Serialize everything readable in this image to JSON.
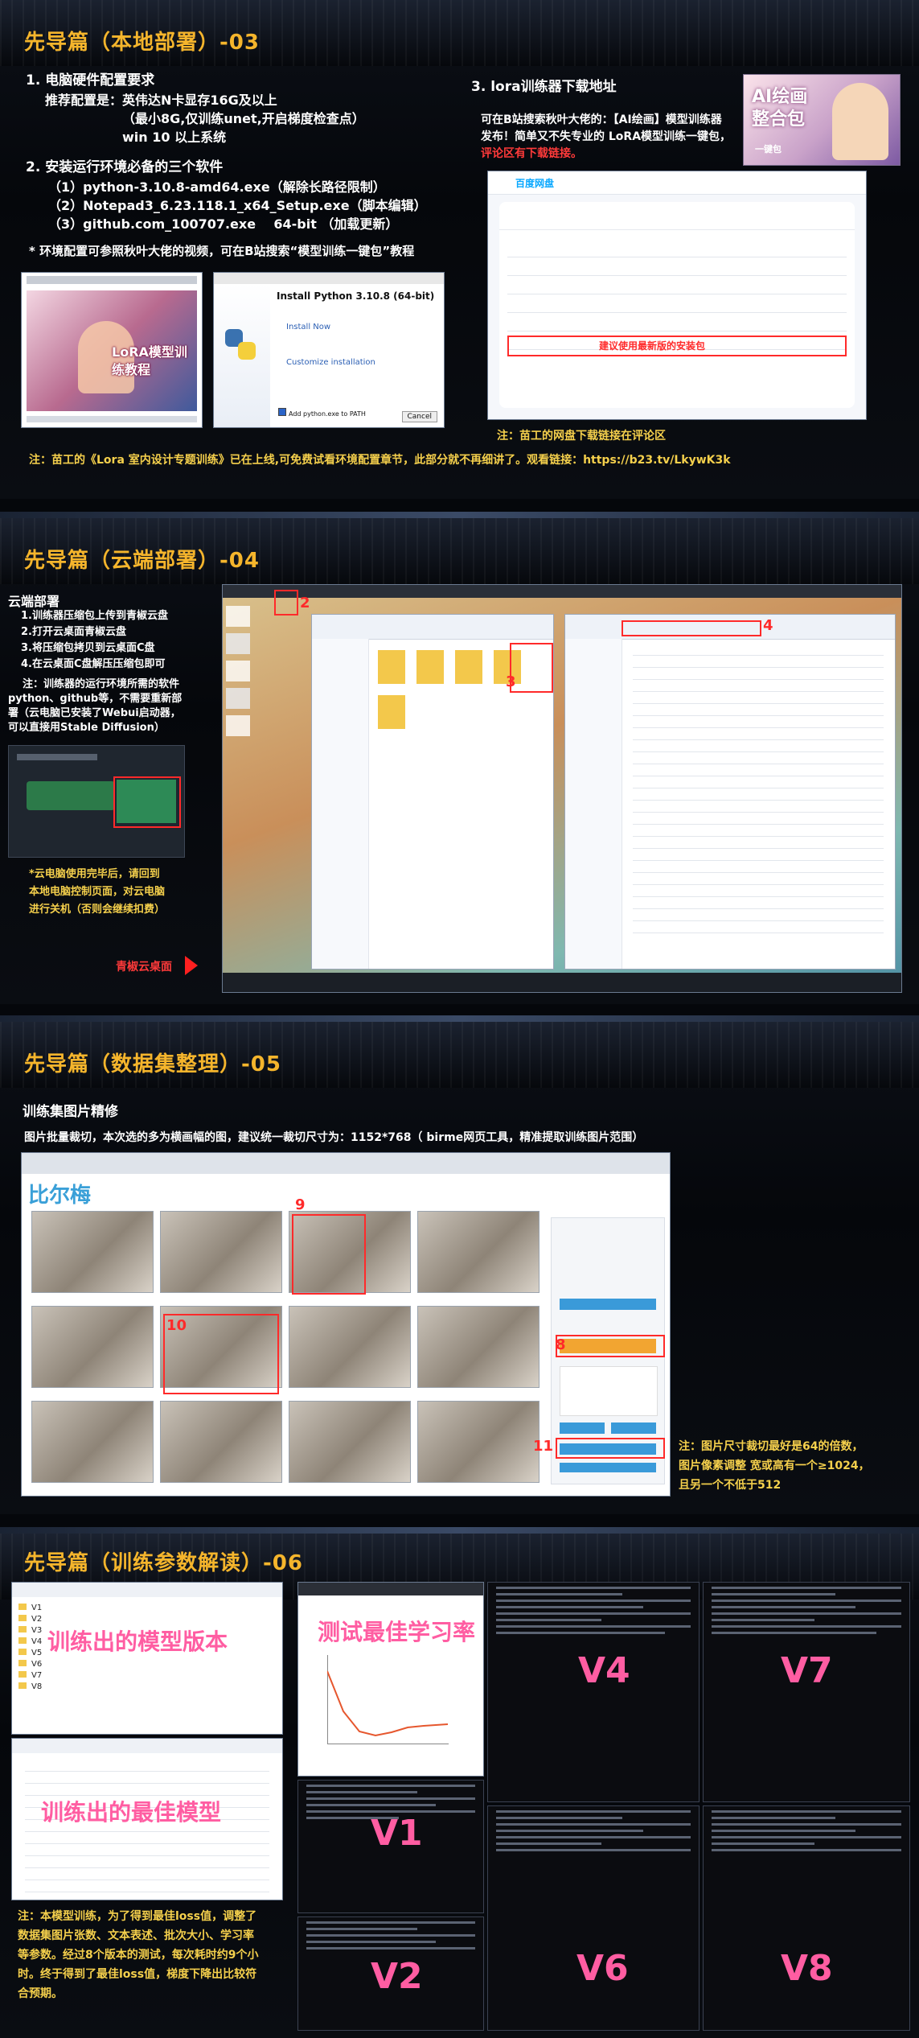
{
  "s1": {
    "title": "先导篇（本地部署）-03",
    "h1": "1. 电脑硬件配置要求",
    "l1": "推荐配置是：英伟达N卡显存16G及以上",
    "l2": "（最小8G,仅训练unet,开启梯度检查点）",
    "l3": "win 10 以上系统",
    "h2": "2. 安装运行环境必备的三个软件",
    "p1": "（1）python-3.10.8-amd64.exe（解除长路径限制）",
    "p2": "（2）Notepad3_6.23.118.1_x64_Setup.exe（脚本编辑）",
    "p3": "（3）github.com_100707.exe    64-bit （加载更新）",
    "tip": "* 环境配置可参照秋叶大佬的视频，可在B站搜索“模型训练一键包”教程",
    "h3": "3. lora训练器下载地址",
    "d1": "可在B站搜索秋叶大佬的：【AI绘画】模型训练器",
    "d2": "发布！简单又不失专业的 LoRA模型训练一键包，",
    "d3": "评论区有下载链接。",
    "badge": "AI绘画整合包",
    "badge_sub": "一键包",
    "pan_logo": "百度网盘",
    "pan_hint": "建议使用最新版的安装包",
    "python_title": "Install Python 3.10.8 (64-bit)",
    "python_now": "Install Now",
    "python_custom": "Customize installation",
    "python_path": "Add python.exe to PATH",
    "python_cancel": "Cancel",
    "thumb_text": "LoRA模型训练教程",
    "pan_note": "注：苗工的网盘下载链接在评论区",
    "bottom": "注：苗工的《Lora 室内设计专题训练》已在上线,可免费试看环境配置章节，此部分就不再细讲了。观看链接：https://b23.tv/LkywK3k"
  },
  "s2": {
    "title": "先导篇（云端部署）-04",
    "h": "云端部署",
    "i1": "1.训练器压缩包上传到青椒云盘",
    "i2": "2.打开云桌面青椒云盘",
    "i3": "3.将压缩包拷贝到云桌面C盘",
    "i4": "4.在云桌面C盘解压压缩包即可",
    "note1": "注：训练器的运行环境所需的软件",
    "note2": "python、github等，不需要重新部",
    "note3": "署（云电脑已安装了Webui启动器，",
    "note4": "可以直接用Stable Diffusion）",
    "warn1": "*云电脑使用完毕后，请回到",
    "warn2": "本地电脑控制页面，对云电脑",
    "warn3": "进行关机（否则会继续扣费）",
    "arrow_label": "青椒云桌面",
    "n2": "2",
    "n3": "3",
    "n4": "4"
  },
  "s3": {
    "title": "先导篇（数据集整理）-05",
    "h": "训练集图片精修",
    "sub": "图片批量裁切，本次选的多为横画幅的图，建议统一裁切尺寸为：1152*768（ birme网页工具，精准提取训练图片范围）",
    "site": "比尔梅",
    "n8": "8",
    "n9": "9",
    "n10": "10",
    "n11": "11",
    "note1": "注：图片尺寸裁切最好是64的倍数，",
    "note2": "图片像素调整 宽或高有一个≥1024，",
    "note3": "且另一个不低于512"
  },
  "s4": {
    "title": "先导篇（训练参数解读）-06",
    "lbl1": "训练出的模型版本",
    "lbl2": "训练出的最佳模型",
    "lbl3": "测试最佳学习率",
    "v1": "V1",
    "v2": "V2",
    "v4": "V4",
    "v6": "V6",
    "v7": "V7",
    "v8": "V8",
    "folders": [
      "V1",
      "V2",
      "V3",
      "V4",
      "V5",
      "V6",
      "V7",
      "V8"
    ],
    "note1": "注：本模型训练，为了得到最佳loss值，调整了",
    "note2": "数据集图片张数、文本表述、批次大小、学习率",
    "note3": "等参数。经过8个版本的测试，每次耗时约9个小",
    "note4": "时。终于得到了最佳loss值，梯度下降出比较符",
    "note5": "合预期。"
  }
}
